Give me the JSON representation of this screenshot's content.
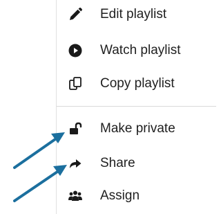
{
  "menu": {
    "items": [
      {
        "label": "Edit playlist",
        "icon": "pencil-icon"
      },
      {
        "label": "Watch playlist",
        "icon": "play-circle-icon"
      },
      {
        "label": "Copy playlist",
        "icon": "copy-icon"
      },
      {
        "label": "Make private",
        "icon": "unlock-icon"
      },
      {
        "label": "Share",
        "icon": "share-arrow-icon"
      },
      {
        "label": "Assign",
        "icon": "users-icon"
      }
    ]
  },
  "colors": {
    "icon": "#1a1a1a",
    "text": "#1f1f1f",
    "arrow_annotation": "#1b6f9e",
    "divider": "#d9d9d9"
  }
}
